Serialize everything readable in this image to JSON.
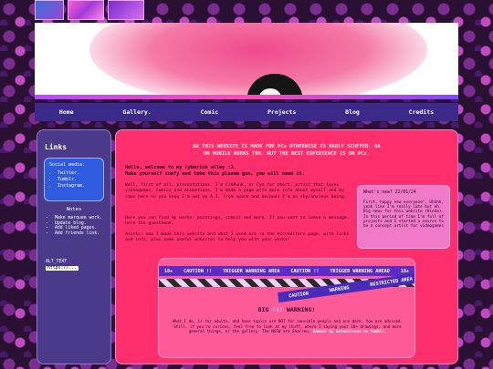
{
  "nav": [
    "Home",
    "Gallery.",
    "Comic",
    "Projects",
    "Blog",
    "Credits"
  ],
  "sidebar": {
    "title": "Links",
    "social_label": "Social media:",
    "social": [
      "Twitter.",
      "Tumblr.",
      "Instagram."
    ],
    "notes_title": "Notes",
    "notes": [
      "Make marquee work.",
      "Update blog.",
      "Add liked pages.",
      "Add friends link."
    ],
    "alt_text": "ALT_TEXT",
    "alt_url": "https://..."
  },
  "main": {
    "warning_line1": "AA  THIS WEBSITE IS MADE FOR PCs OTHERWISE IS BADLY SCUFFED. AA",
    "warning_line2": "ON MOBILE WORKS TOO, BUT THE BEST EXPERIENCE IS ON PCs.",
    "welcome_line1": "Hello, welcome to my cyberish alley :3.",
    "welcome_line2": "Make yourself comfy and take this plasma gun, you will need it.",
    "p1": "Well, first of all, presentations. I'm CimPunk, or Cym for short. artist that loves videogames, comics and animations. I'm made a page with more info about myself and my cams here so you know I'm not an A.I. from space and because I'm an shy/anxious being.",
    "p2": "Here you can find my works: paintings, comics and more. If you want to leave a message, here the guestbook.",
    "p3": "Assets: now I made this website and what I used are in the Accreditors page, with links and info, plus some useful websites to help you with your works!"
  },
  "news": {
    "heading": "What's new? 22/01/24",
    "body": "First, happy new everyone!, Uhhhh, yeah like I'm really late but eh. Big news for this website (Kinda). In this period of time I'm full of projects and I started a course to be a concept artist for videogames"
  },
  "caution": {
    "tape1": [
      "18+",
      "CAUTION !!",
      "TRIGGER WARNING AREA",
      "CAUTION !!",
      "TRIGGER WARNING AHEAD",
      "18+"
    ],
    "tape3": [
      "CAUTION",
      "WARNING",
      "RESTRICTED AREA"
    ],
    "title_a": "BIG ",
    "title_b": "FAT",
    "title_c": " WARNING!",
    "body": "What I do, is for adults, and have topics are NOT for sensible people and are dark. You are advised. Still, if you're curious, feel free to look at my stuff, where I saying your 18+ drawings, and more general things, or the gallery. The NSFW are Sharreu.",
    "link": "Banner by katoniissee on tumblr."
  }
}
